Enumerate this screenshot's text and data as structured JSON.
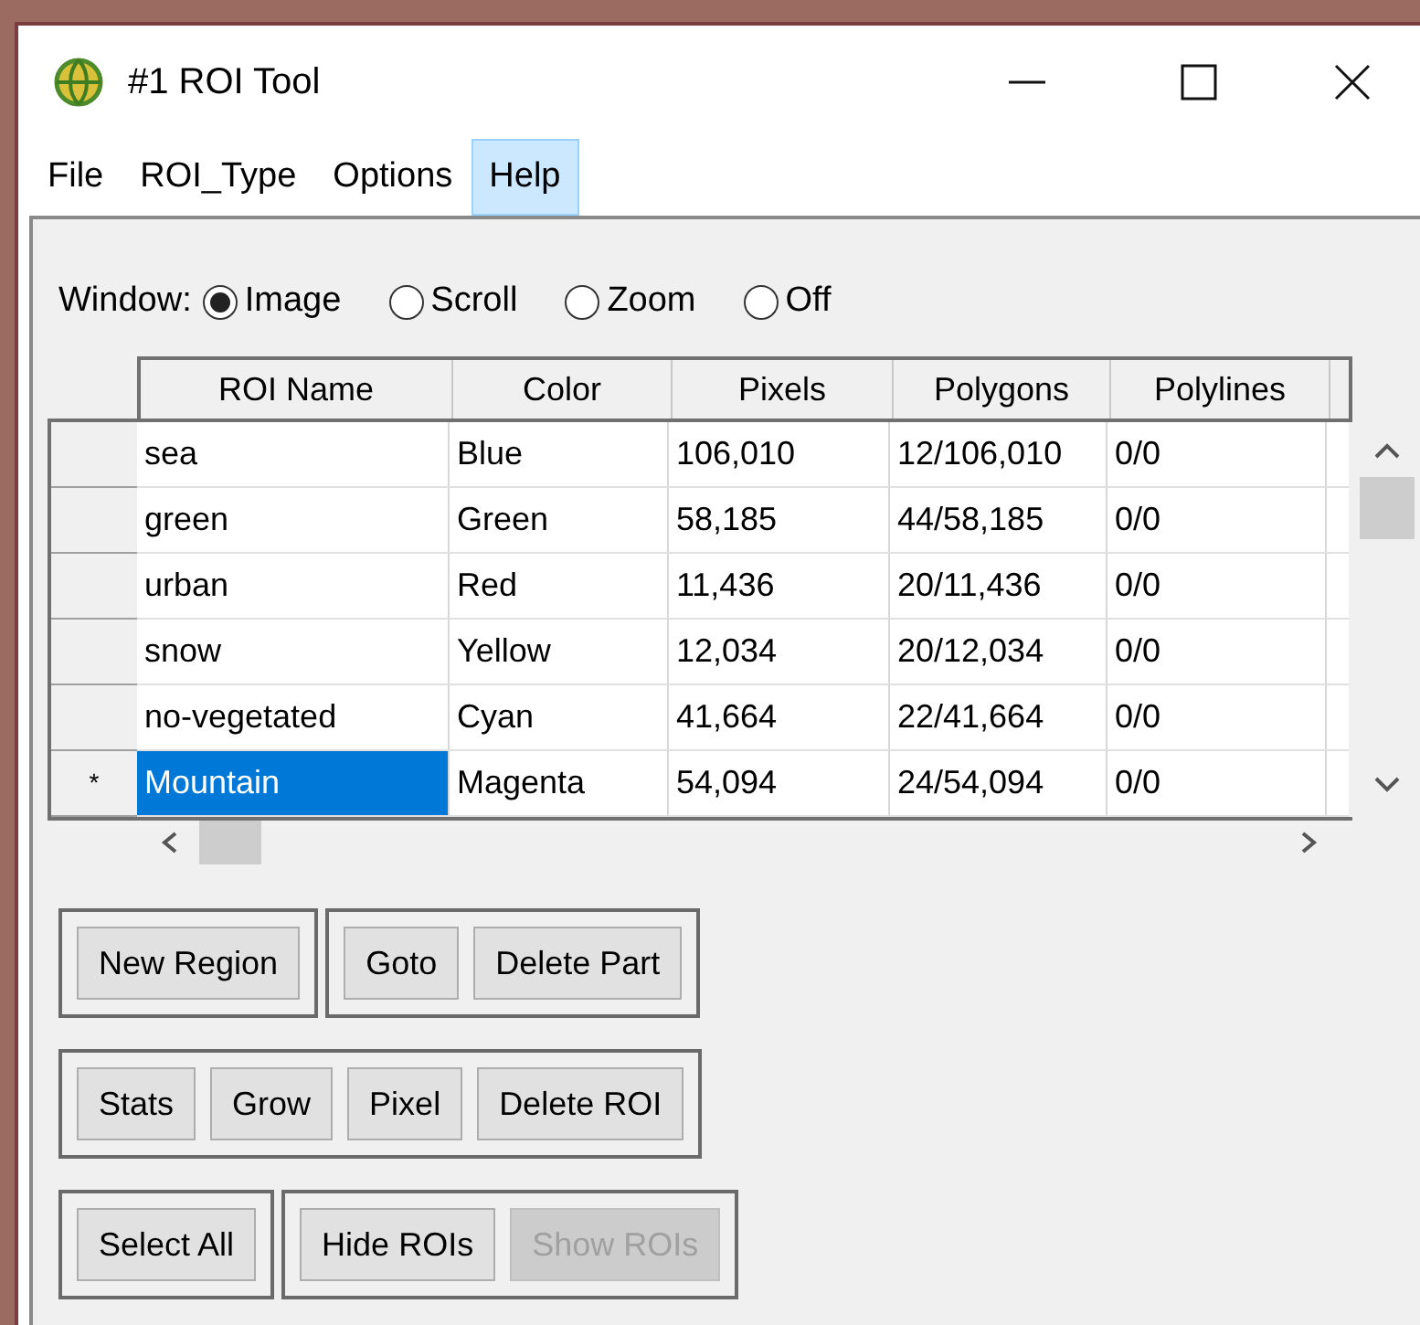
{
  "window": {
    "title": "#1 ROI Tool"
  },
  "menu": [
    {
      "label": "File",
      "selected": false
    },
    {
      "label": "ROI_Type",
      "selected": false
    },
    {
      "label": "Options",
      "selected": false
    },
    {
      "label": "Help",
      "selected": true
    }
  ],
  "window_mode": {
    "label": "Window:",
    "options": [
      {
        "label": "Image",
        "selected": true
      },
      {
        "label": "Scroll",
        "selected": false
      },
      {
        "label": "Zoom",
        "selected": false
      },
      {
        "label": "Off",
        "selected": false
      }
    ]
  },
  "table": {
    "columns": [
      "ROI Name",
      "Color",
      "Pixels",
      "Polygons",
      "Polylines"
    ],
    "rows": [
      {
        "marker": "",
        "selected": false,
        "cells": [
          "sea",
          "Blue",
          "106,010",
          "12/106,010",
          "0/0"
        ]
      },
      {
        "marker": "",
        "selected": false,
        "cells": [
          "green",
          "Green",
          "58,185",
          "44/58,185",
          "0/0"
        ]
      },
      {
        "marker": "",
        "selected": false,
        "cells": [
          "urban",
          "Red",
          "11,436",
          "20/11,436",
          "0/0"
        ]
      },
      {
        "marker": "",
        "selected": false,
        "cells": [
          "snow",
          "Yellow",
          "12,034",
          "20/12,034",
          "0/0"
        ]
      },
      {
        "marker": "",
        "selected": false,
        "cells": [
          "no-vegetated",
          "Cyan",
          "41,664",
          "22/41,664",
          "0/0"
        ]
      },
      {
        "marker": "*",
        "selected": true,
        "cells": [
          "Mountain",
          "Magenta",
          "54,094",
          "24/54,094",
          "0/0"
        ]
      }
    ]
  },
  "button_rows": [
    [
      [
        {
          "label": "New Region",
          "disabled": false
        }
      ],
      [
        {
          "label": "Goto",
          "disabled": false
        },
        {
          "label": "Delete Part",
          "disabled": false
        }
      ]
    ],
    [
      [
        {
          "label": "Stats",
          "disabled": false
        },
        {
          "label": "Grow",
          "disabled": false
        },
        {
          "label": "Pixel",
          "disabled": false
        },
        {
          "label": "Delete ROI",
          "disabled": false
        }
      ]
    ],
    [
      [
        {
          "label": "Select All",
          "disabled": false
        }
      ],
      [
        {
          "label": "Hide ROIs",
          "disabled": false
        },
        {
          "label": "Show ROIs",
          "disabled": true
        }
      ]
    ]
  ]
}
